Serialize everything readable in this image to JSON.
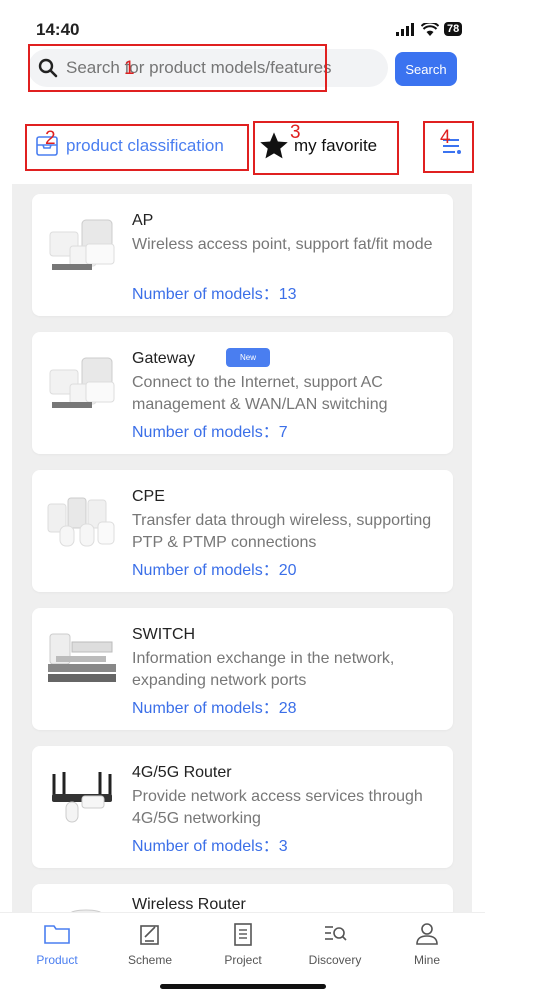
{
  "status": {
    "time": "14:40",
    "battery": "78"
  },
  "search": {
    "placeholder": "Search for product models/features",
    "button": "Search"
  },
  "annotations": [
    "1",
    "2",
    "3",
    "4"
  ],
  "tabs": {
    "classification": "product classification",
    "favorite": "my favorite"
  },
  "products": [
    {
      "title": "AP",
      "desc": "Wireless access point, support fat/fit mode",
      "count": "Number of models：13"
    },
    {
      "title": "Gateway",
      "badge": "New",
      "desc": "Connect to the Internet, support AC management & WAN/LAN switching",
      "count": "Number of models：7"
    },
    {
      "title": "CPE",
      "desc": "Transfer data through wireless, supporting PTP & PTMP connections",
      "count": "Number of models：20"
    },
    {
      "title": "SWITCH",
      "desc": "Information exchange in the network, expanding network ports",
      "count": "Number of models：28"
    },
    {
      "title": "4G/5G Router",
      "desc": "Provide network access services through 4G/5G networking",
      "count": "Number of models：3"
    },
    {
      "title": "Wireless Router"
    }
  ],
  "nav": {
    "product": "Product",
    "scheme": "Scheme",
    "project": "Project",
    "discovery": "Discovery",
    "mine": "Mine"
  },
  "colors": {
    "accent": "#3b73f0",
    "annotation": "#e02020"
  }
}
